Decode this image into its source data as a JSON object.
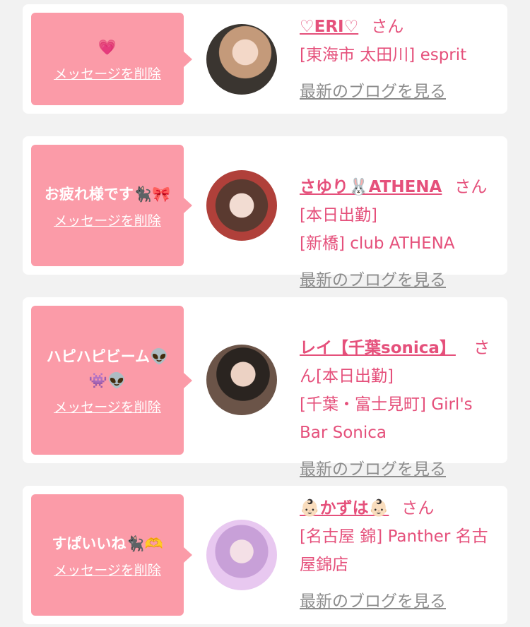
{
  "cards": [
    {
      "message": "💗",
      "delete_label": "メッセージを削除",
      "name": "♡ERI♡",
      "honorific": "さん",
      "details": "[東海市 太田川] esprit",
      "blog_label": "最新のブログを見る"
    },
    {
      "message": "お疲れ様です🐈‍⬛🎀",
      "delete_label": "メッセージを削除",
      "name": "さゆり🐰ATHENA",
      "honorific": "さん",
      "details": "[本日出勤]\n[新橋] club ATHENA",
      "blog_label": "最新のブログを見る"
    },
    {
      "message": "ハピハピビーム👽👾👽",
      "delete_label": "メッセージを削除",
      "name": "レイ【千葉sonica】",
      "honorific": "さん",
      "details": "[本日出勤]\n[千葉・富士見町] Girl's Bar Sonica",
      "blog_label": "最新のブログを見る"
    },
    {
      "message": "すぱいいね🐈‍⬛🫶",
      "delete_label": "メッセージを削除",
      "name": "👶🏻かずは👶🏻",
      "honorific": "さん",
      "details": "[名古屋 錦] Panther 名古屋錦店",
      "blog_label": "最新のブログを見る"
    }
  ]
}
